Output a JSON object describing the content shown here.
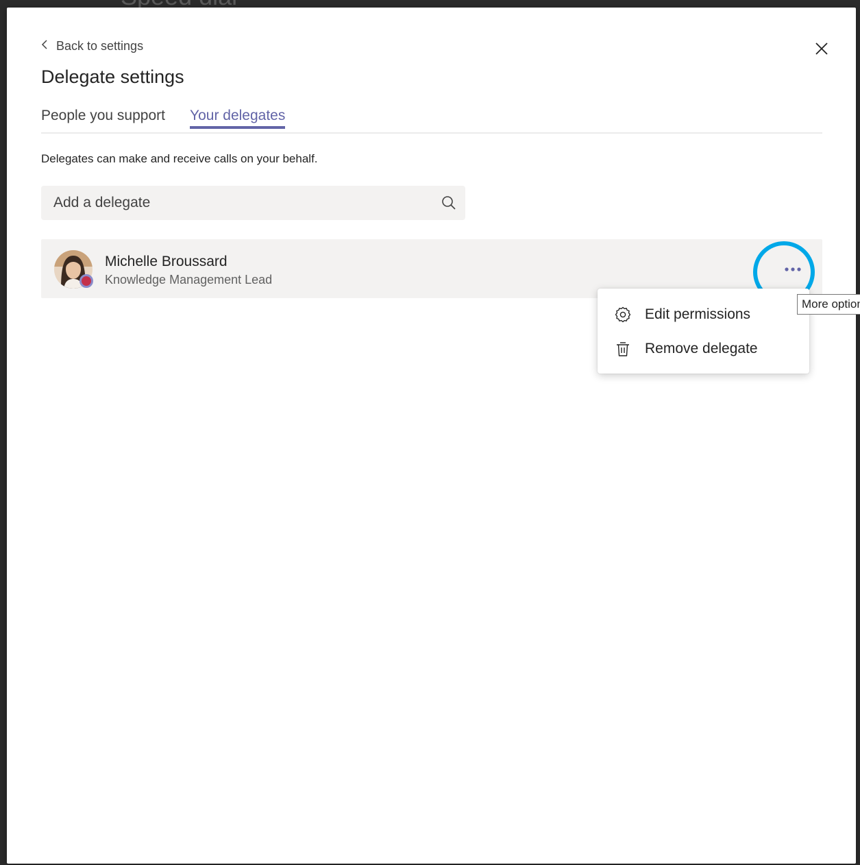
{
  "background": {
    "text": "Speed dial"
  },
  "dialog": {
    "back_label": "Back to settings",
    "title": "Delegate settings",
    "close_label": "Close"
  },
  "tabs": [
    {
      "label": "People you support",
      "active": false
    },
    {
      "label": "Your delegates",
      "active": true
    }
  ],
  "description": "Delegates can make and receive calls on your behalf.",
  "search": {
    "placeholder": "Add a delegate",
    "value": ""
  },
  "delegates": [
    {
      "name": "Michelle Broussard",
      "role": "Knowledge Management Lead",
      "status": "busy",
      "status_color": "#c4314b"
    }
  ],
  "tooltip": "More options",
  "menu": {
    "items": [
      {
        "label": "Edit permissions",
        "icon": "gear-icon"
      },
      {
        "label": "Remove delegate",
        "icon": "trash-icon"
      }
    ]
  },
  "colors": {
    "accent": "#6264a7",
    "highlight_ring": "#00a8e8",
    "row_background": "#f3f2f1"
  }
}
